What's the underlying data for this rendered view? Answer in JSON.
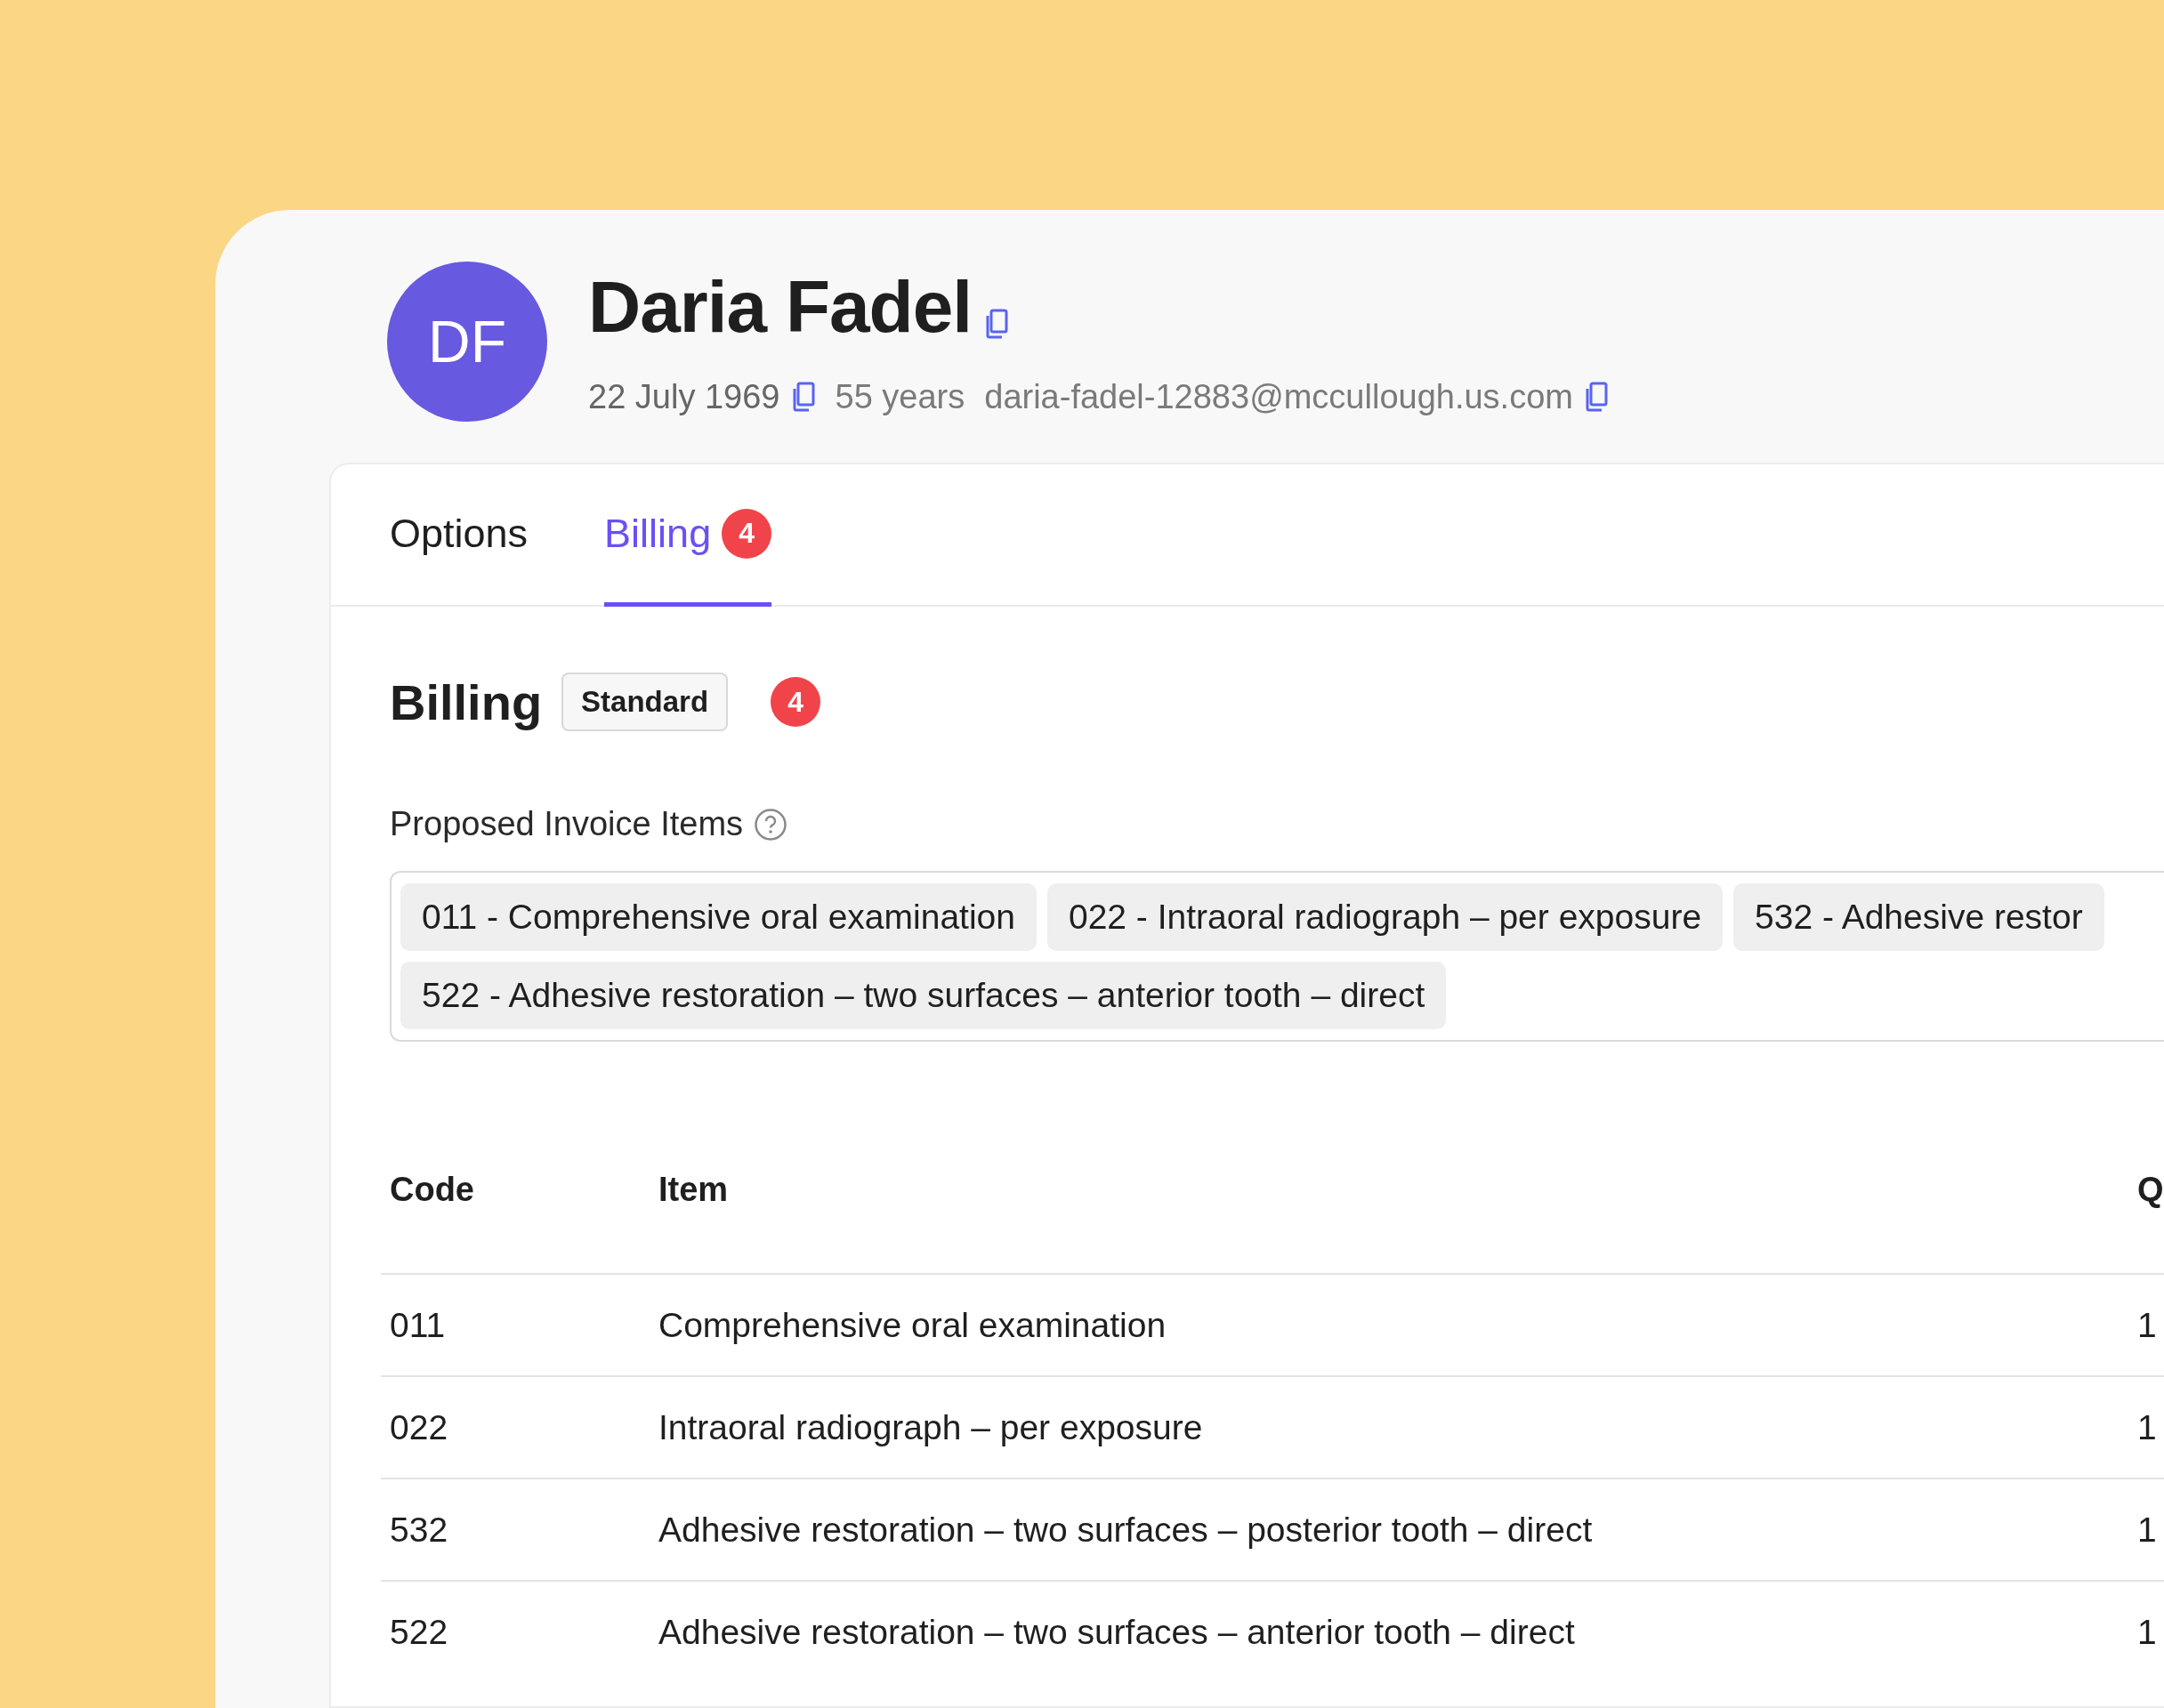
{
  "patient": {
    "initials": "DF",
    "name": "Daria Fadel",
    "birth_date": "22 July 1969",
    "age": "55 years",
    "email": "daria-fadel-12883@mccullough.us.com"
  },
  "tabs": [
    {
      "label": "Options",
      "selected": false
    },
    {
      "label": "Billing",
      "selected": true,
      "badge": "4"
    }
  ],
  "billing": {
    "title": "Billing",
    "plan": "Standard",
    "badge": "4",
    "proposed_label": "Proposed Invoice Items",
    "proposed_items": [
      "011 - Comprehensive oral examination",
      "022 - Intraoral radiograph – per exposure",
      "532 - Adhesive restor",
      "522 - Adhesive restoration – two surfaces – anterior tooth – direct"
    ],
    "table": {
      "columns": [
        "Code",
        "Item",
        "Q"
      ],
      "rows": [
        [
          "011",
          "Comprehensive oral examination",
          "1"
        ],
        [
          "022",
          "Intraoral radiograph – per exposure",
          "1"
        ],
        [
          "532",
          "Adhesive restoration – two surfaces – posterior tooth – direct",
          "1"
        ],
        [
          "522",
          "Adhesive restoration – two surfaces – anterior tooth – direct",
          "1"
        ]
      ]
    }
  }
}
